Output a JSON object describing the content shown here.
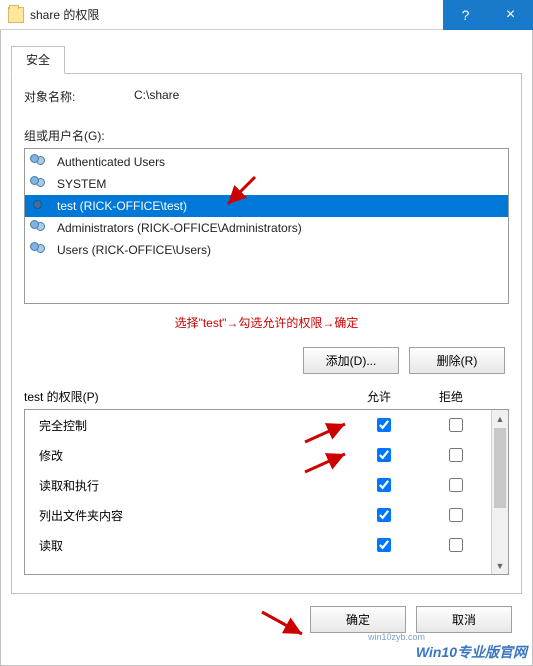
{
  "window": {
    "title": "share 的权限",
    "help": "?",
    "close": "×"
  },
  "tab": {
    "security": "安全"
  },
  "object": {
    "label": "对象名称:",
    "value": "C:\\share"
  },
  "groups": {
    "label": "组或用户名(G):",
    "items": [
      {
        "name": "Authenticated Users",
        "single": false,
        "selected": false
      },
      {
        "name": "SYSTEM",
        "single": false,
        "selected": false
      },
      {
        "name": "test (RICK-OFFICE\\test)",
        "single": true,
        "selected": true
      },
      {
        "name": "Administrators (RICK-OFFICE\\Administrators)",
        "single": false,
        "selected": false
      },
      {
        "name": "Users (RICK-OFFICE\\Users)",
        "single": false,
        "selected": false
      }
    ],
    "hint": "选择\"test\"→勾选允许的权限→确定"
  },
  "buttons": {
    "add": "添加(D)...",
    "remove": "删除(R)",
    "ok": "确定",
    "cancel": "取消"
  },
  "perm": {
    "header_label": "test 的权限(P)",
    "col_allow": "允许",
    "col_deny": "拒绝",
    "rows": [
      {
        "label": "完全控制",
        "allow": true,
        "deny": false
      },
      {
        "label": "修改",
        "allow": true,
        "deny": false
      },
      {
        "label": "读取和执行",
        "allow": true,
        "deny": false
      },
      {
        "label": "列出文件夹内容",
        "allow": true,
        "deny": false
      },
      {
        "label": "读取",
        "allow": true,
        "deny": false
      }
    ]
  }
}
